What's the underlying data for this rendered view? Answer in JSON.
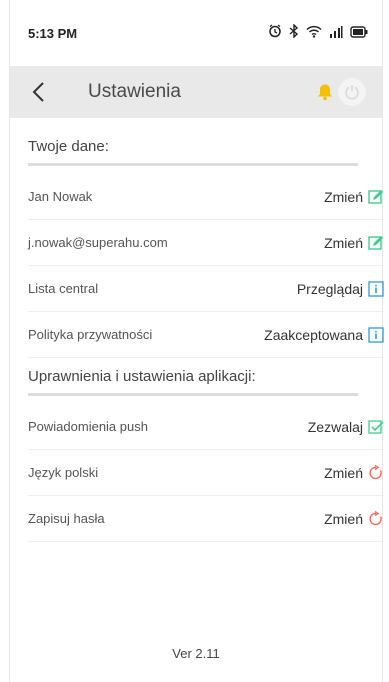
{
  "statusbar": {
    "time": "5:13 PM"
  },
  "header": {
    "title": "Ustawienia"
  },
  "section_user": {
    "title": "Twoje dane:",
    "rows": [
      {
        "label": "Jan Nowak",
        "action": "Zmień",
        "icon": "edit-icon"
      },
      {
        "label": "j.nowak@superahu.com",
        "action": "Zmień",
        "icon": "edit-icon"
      },
      {
        "label": "Lista central",
        "action": "Przeglądaj",
        "icon": "info-icon"
      },
      {
        "label": "Polityka przywatności",
        "action": "Zaakceptowana",
        "icon": "info-icon"
      }
    ]
  },
  "section_app": {
    "title": "Uprawnienia i ustawienia aplikacji:",
    "rows": [
      {
        "label": "Powiadomienia push",
        "action": "Zezwalaj",
        "icon": "checkbox-checked-icon"
      },
      {
        "label": "Język polski",
        "action": "Zmień",
        "icon": "refresh-icon"
      },
      {
        "label": "Zapisuj hasła",
        "action": "Zmień",
        "icon": "refresh-icon"
      }
    ]
  },
  "footer": {
    "version": "Ver 2.11"
  },
  "colors": {
    "accent_green": "#3ecf8e",
    "accent_blue": "#2d9cdb",
    "accent_red": "#ef6b5a",
    "bell": "#f5c000"
  }
}
